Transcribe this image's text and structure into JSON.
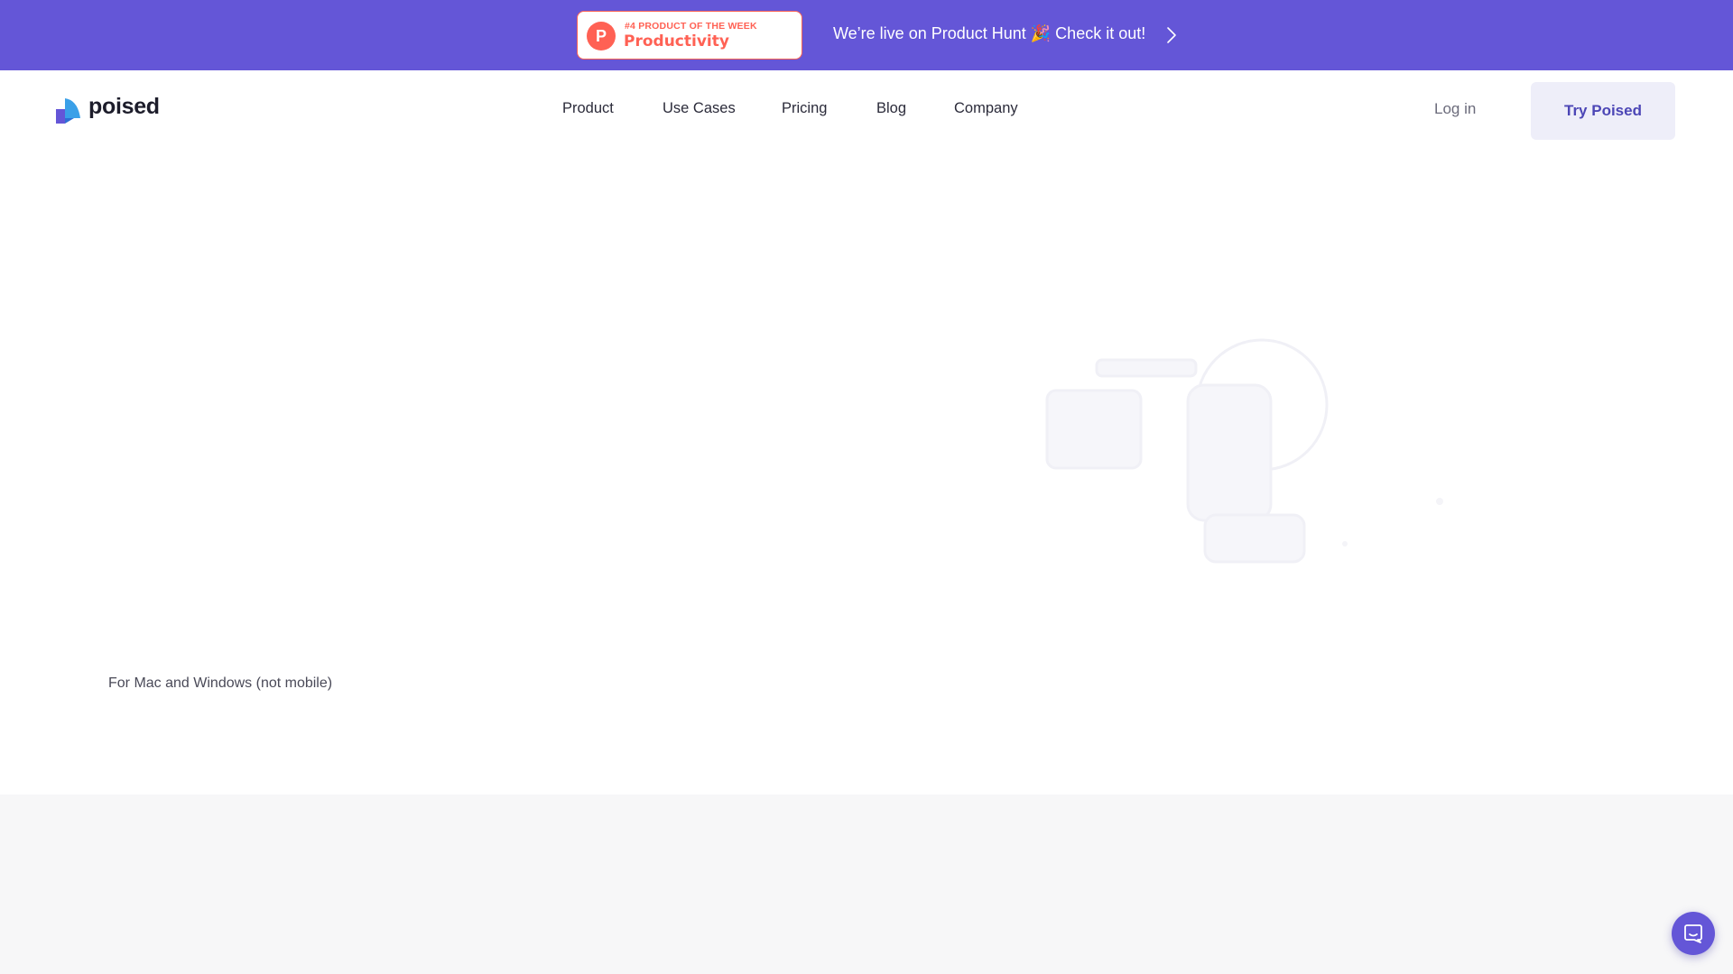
{
  "announcement": {
    "badge": {
      "kicker": "#4 PRODUCT OF THE WEEK",
      "category": "Productivity",
      "logo_letter": "P",
      "icon": "product-hunt-icon"
    },
    "text": "We’re live on Product Hunt 🎉 Check it out!",
    "arrow_icon": "chevron-right-icon"
  },
  "header": {
    "logo_text": "poised",
    "logo_icon": "poised-logo-icon",
    "nav": {
      "product": "Product",
      "use_cases": "Use Cases",
      "pricing": "Pricing",
      "blog": "Blog",
      "company": "Company"
    },
    "login_label": "Log in",
    "cta_label": "Try Poised"
  },
  "hero": {
    "platform_note": "For Mac and Windows (not mobile)"
  },
  "chat": {
    "icon": "chat-icon"
  },
  "colors": {
    "brand_purple": "#6456d7",
    "product_hunt_orange": "#ff6154",
    "cta_background": "#eeeef9",
    "cta_text": "#4c46b6",
    "section_gray": "#f7f7f8"
  }
}
